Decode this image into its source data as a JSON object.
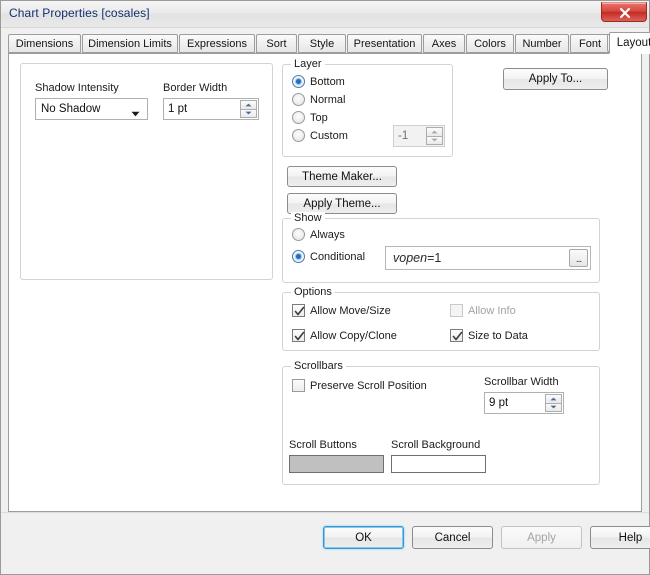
{
  "window": {
    "title": "Chart Properties [cosales]",
    "close_icon": "close-icon"
  },
  "tabs": {
    "items": [
      {
        "label": "Dimensions",
        "active": false
      },
      {
        "label": "Dimension Limits",
        "active": false
      },
      {
        "label": "Expressions",
        "active": false
      },
      {
        "label": "Sort",
        "active": false
      },
      {
        "label": "Style",
        "active": false
      },
      {
        "label": "Presentation",
        "active": false
      },
      {
        "label": "Axes",
        "active": false
      },
      {
        "label": "Colors",
        "active": false
      },
      {
        "label": "Number",
        "active": false
      },
      {
        "label": "Font",
        "active": false
      },
      {
        "label": "Layout",
        "active": true
      }
    ],
    "scroll_left_icon": "triangle-left-icon",
    "scroll_right_icon": "triangle-right-icon"
  },
  "left_panel": {
    "shadow_intensity": {
      "label": "Shadow Intensity",
      "value": "No Shadow",
      "arrow_icon": "chevron-down-icon"
    },
    "border_width": {
      "label": "Border Width",
      "value": "1 pt",
      "up_icon": "spinner-up-icon",
      "down_icon": "spinner-down-icon"
    }
  },
  "layer_group": {
    "legend": "Layer",
    "options": [
      {
        "label": "Bottom",
        "selected": true
      },
      {
        "label": "Normal",
        "selected": false
      },
      {
        "label": "Top",
        "selected": false
      },
      {
        "label": "Custom",
        "selected": false
      }
    ],
    "custom_value": "-1",
    "custom_enabled": false
  },
  "theme_buttons": {
    "theme_maker": "Theme Maker...",
    "apply_theme": "Apply Theme..."
  },
  "apply_to": {
    "label": "Apply To..."
  },
  "show_group": {
    "legend": "Show",
    "options": [
      {
        "label": "Always",
        "selected": false
      },
      {
        "label": "Conditional",
        "selected": true
      }
    ],
    "conditional_expression_italic": "vopen",
    "conditional_expression_rest": "=1",
    "browse_label": "...",
    "browse_icon": "ellipsis-icon"
  },
  "options_group": {
    "legend": "Options",
    "items": [
      {
        "label": "Allow Move/Size",
        "checked": true,
        "enabled": true
      },
      {
        "label": "Allow Info",
        "checked": false,
        "enabled": false
      },
      {
        "label": "Allow Copy/Clone",
        "checked": true,
        "enabled": true
      },
      {
        "label": "Size to Data",
        "checked": true,
        "enabled": true
      }
    ]
  },
  "scrollbars_group": {
    "legend": "Scrollbars",
    "preserve_scroll_position": {
      "label": "Preserve Scroll Position",
      "checked": false
    },
    "scrollbar_width": {
      "label": "Scrollbar Width",
      "value": "9 pt",
      "up_icon": "spinner-up-icon",
      "down_icon": "spinner-down-icon"
    },
    "scroll_buttons": {
      "label": "Scroll Buttons",
      "color": "#c0c0c0"
    },
    "scroll_background": {
      "label": "Scroll Background",
      "color": "#ffffff"
    }
  },
  "footer": {
    "ok": "OK",
    "cancel": "Cancel",
    "apply": "Apply",
    "help": "Help"
  }
}
